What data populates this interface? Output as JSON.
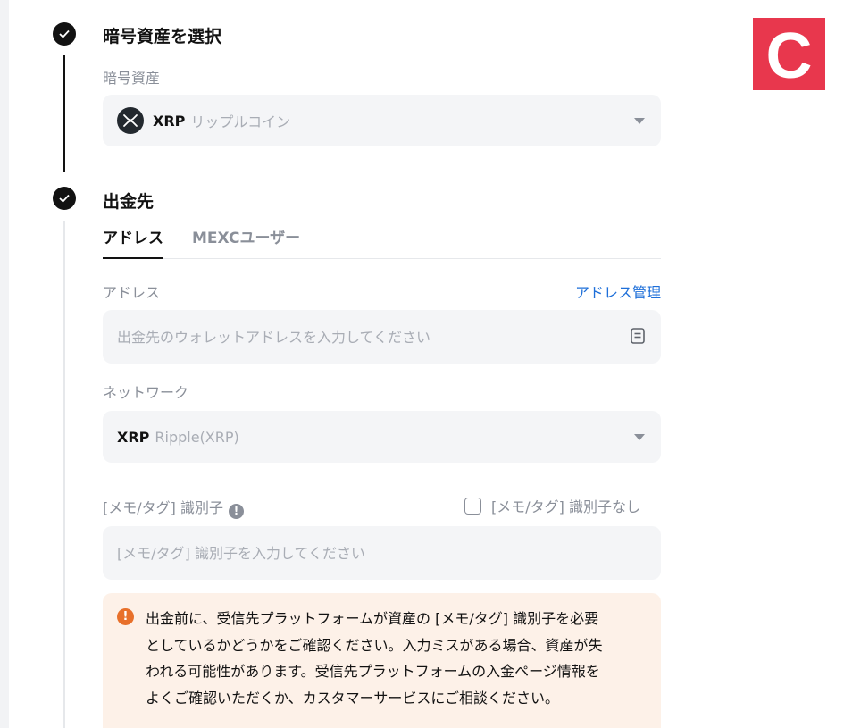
{
  "step1": {
    "title": "暗号資産を選択",
    "label": "暗号資産",
    "coin_symbol": "XRP",
    "coin_name": "リップルコイン"
  },
  "step2": {
    "title": "出金先",
    "tabs": [
      {
        "label": "アドレス",
        "active": true
      },
      {
        "label": "MEXCユーザー",
        "active": false
      }
    ],
    "address_label": "アドレス",
    "address_manage_link": "アドレス管理",
    "address_placeholder": "出金先のウォレットアドレスを入力してください",
    "network_label": "ネットワーク",
    "network_symbol": "XRP",
    "network_name": "Ripple(XRP)",
    "memo_label": "[メモ/タグ] 識別子",
    "memo_none_label": "[メモ/タグ] 識別子なし",
    "memo_none_checked": false,
    "memo_placeholder": "[メモ/タグ] 識別子を入力してください",
    "warning_lines": [
      "出金前に、受信先プラットフォームが資産の [メモ/タグ] 識別子を必要",
      "としているかどうかをご確認ください。入力ミスがある場合、資産が失",
      "われる可能性があります。受信先プラットフォームの入金ページ情報を",
      "よくご確認いただくか、カスタマーサービスにご相談ください。"
    ]
  },
  "brand_logo_letter": "C",
  "colors": {
    "accent_link": "#1e6fd9",
    "warning_bg": "#fdf1e8",
    "warning_icon": "#e8702a",
    "brand": "#e8374d"
  }
}
